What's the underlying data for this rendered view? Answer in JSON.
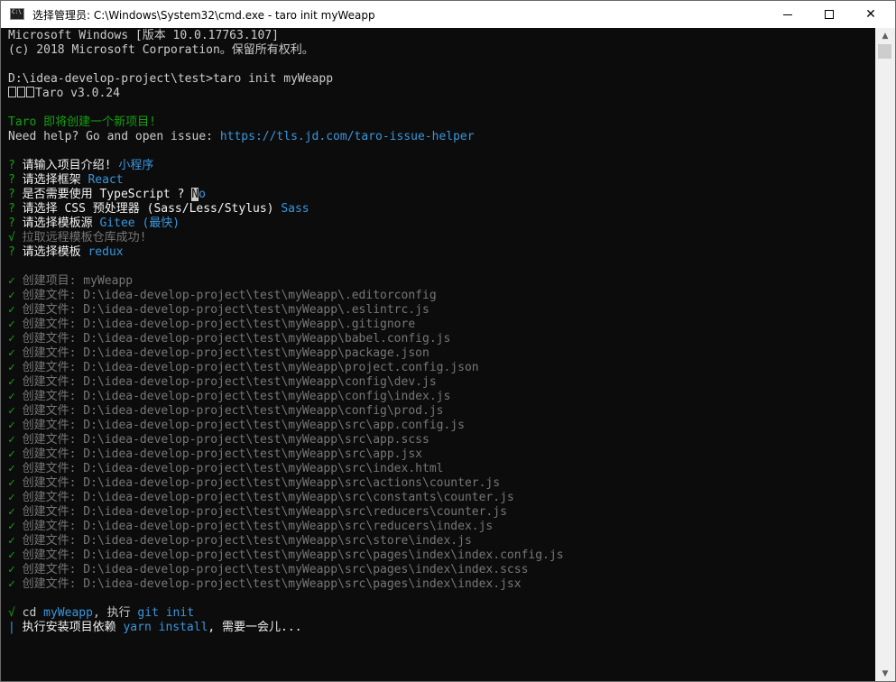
{
  "window": {
    "title": "选择管理员: C:\\Windows\\System32\\cmd.exe - taro  init myWeapp",
    "icon": "cmd-icon",
    "controls": {
      "minimize": "minimize",
      "maximize": "maximize",
      "close": "close"
    }
  },
  "colors": {
    "background": "#0c0c0c",
    "text": "#cccccc",
    "green": "#13a10e",
    "cyan": "#3a96dd",
    "gray": "#767676"
  },
  "console": {
    "header1": "Microsoft Windows [版本 10.0.17763.107]",
    "header2": "(c) 2018 Microsoft Corporation。保留所有权利。",
    "prompt": "D:\\idea-develop-project\\test>taro init myWeapp",
    "taro_version": "Taro v3.0.24",
    "create_msg": "Taro 即将创建一个新项目!",
    "help_prefix": "Need help? Go and open issue: ",
    "help_url": "https://tls.jd.com/taro-issue-helper",
    "questions": [
      {
        "mark": "?",
        "label": "请输入项目介绍! ",
        "answer": "小程序"
      },
      {
        "mark": "?",
        "label": "请选择框架 ",
        "answer": "React"
      },
      {
        "mark": "?",
        "label": "是否需要使用 TypeScript ? ",
        "answer_cursor": "N",
        "answer": "o"
      },
      {
        "mark": "?",
        "label": "请选择 CSS 预处理器 (Sass/Less/Stylus) ",
        "answer": "Sass"
      },
      {
        "mark": "?",
        "label": "请选择模板源 ",
        "answer": "Gitee (最快)"
      },
      {
        "mark": "√",
        "label": "拉取远程模板仓库成功!"
      },
      {
        "mark": "?",
        "label": "请选择模板 ",
        "answer": "redux"
      }
    ],
    "created_items": [
      "创建项目: myWeapp",
      "创建文件: D:\\idea-develop-project\\test\\myWeapp\\.editorconfig",
      "创建文件: D:\\idea-develop-project\\test\\myWeapp\\.eslintrc.js",
      "创建文件: D:\\idea-develop-project\\test\\myWeapp\\.gitignore",
      "创建文件: D:\\idea-develop-project\\test\\myWeapp\\babel.config.js",
      "创建文件: D:\\idea-develop-project\\test\\myWeapp\\package.json",
      "创建文件: D:\\idea-develop-project\\test\\myWeapp\\project.config.json",
      "创建文件: D:\\idea-develop-project\\test\\myWeapp\\config\\dev.js",
      "创建文件: D:\\idea-develop-project\\test\\myWeapp\\config\\index.js",
      "创建文件: D:\\idea-develop-project\\test\\myWeapp\\config\\prod.js",
      "创建文件: D:\\idea-develop-project\\test\\myWeapp\\src\\app.config.js",
      "创建文件: D:\\idea-develop-project\\test\\myWeapp\\src\\app.scss",
      "创建文件: D:\\idea-develop-project\\test\\myWeapp\\src\\app.jsx",
      "创建文件: D:\\idea-develop-project\\test\\myWeapp\\src\\index.html",
      "创建文件: D:\\idea-develop-project\\test\\myWeapp\\src\\actions\\counter.js",
      "创建文件: D:\\idea-develop-project\\test\\myWeapp\\src\\constants\\counter.js",
      "创建文件: D:\\idea-develop-project\\test\\myWeapp\\src\\reducers\\counter.js",
      "创建文件: D:\\idea-develop-project\\test\\myWeapp\\src\\reducers\\index.js",
      "创建文件: D:\\idea-develop-project\\test\\myWeapp\\src\\store\\index.js",
      "创建文件: D:\\idea-develop-project\\test\\myWeapp\\src\\pages\\index\\index.config.js",
      "创建文件: D:\\idea-develop-project\\test\\myWeapp\\src\\pages\\index\\index.scss",
      "创建文件: D:\\idea-develop-project\\test\\myWeapp\\src\\pages\\index\\index.jsx"
    ],
    "git_line": {
      "mark": "√",
      "cd": " cd ",
      "project": "myWeapp",
      "mid": ", 执行 ",
      "cmd": "git init"
    },
    "install_line": {
      "mark": "|",
      "label": " 执行安装项目依赖 ",
      "cmd": "yarn install",
      "rest": ", 需要一会儿..."
    }
  }
}
